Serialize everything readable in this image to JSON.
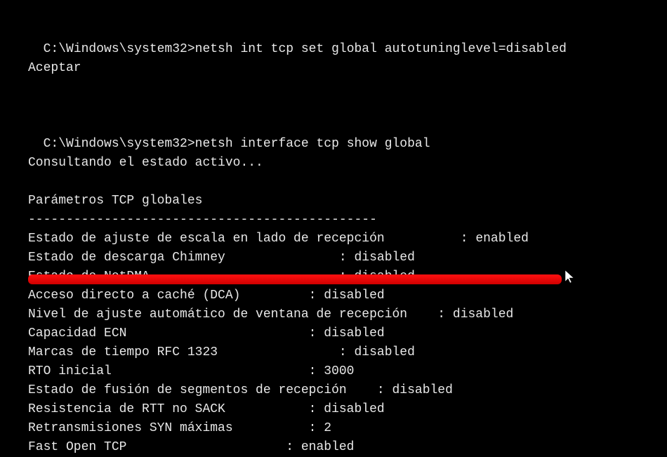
{
  "prompt1": "C:\\Windows\\system32>",
  "command1": "netsh int tcp set global autotuninglevel=disabled",
  "response1": "Aceptar",
  "prompt2": "C:\\Windows\\system32>",
  "command2": "netsh interface tcp show global",
  "response2": "Consultando el estado activo...",
  "heading": "Parámetros TCP globales",
  "divider": "----------------------------------------------",
  "params": [
    {
      "label": "Estado de ajuste de escala en lado de recepción          ",
      "colon": ": ",
      "value": "enabled"
    },
    {
      "label": "Estado de descarga Chimney               ",
      "colon": ": ",
      "value": "disabled"
    },
    {
      "label": "Estado de NetDMA                         ",
      "colon": ": ",
      "value": "disabled"
    },
    {
      "label": "Acceso directo a caché (DCA)         ",
      "colon": ": ",
      "value": "disabled"
    },
    {
      "label": "Nivel de ajuste automático de ventana de recepción    ",
      "colon": ": ",
      "value": "disabled"
    },
    {
      "label": "",
      "colon": "",
      "value": ""
    },
    {
      "label": "Capacidad ECN                        ",
      "colon": ": ",
      "value": "disabled"
    },
    {
      "label": "Marcas de tiempo RFC 1323                ",
      "colon": ": ",
      "value": "disabled"
    },
    {
      "label": "RTO inicial                          ",
      "colon": ": ",
      "value": "3000"
    },
    {
      "label": "Estado de fusión de segmentos de recepción    ",
      "colon": ": ",
      "value": "disabled"
    },
    {
      "label": "Resistencia de RTT no SACK           ",
      "colon": ": ",
      "value": "disabled"
    },
    {
      "label": "Retransmisiones SYN máximas          ",
      "colon": ": ",
      "value": "2"
    },
    {
      "label": "Fast Open TCP                     ",
      "colon": ": ",
      "value": "enabled"
    }
  ]
}
